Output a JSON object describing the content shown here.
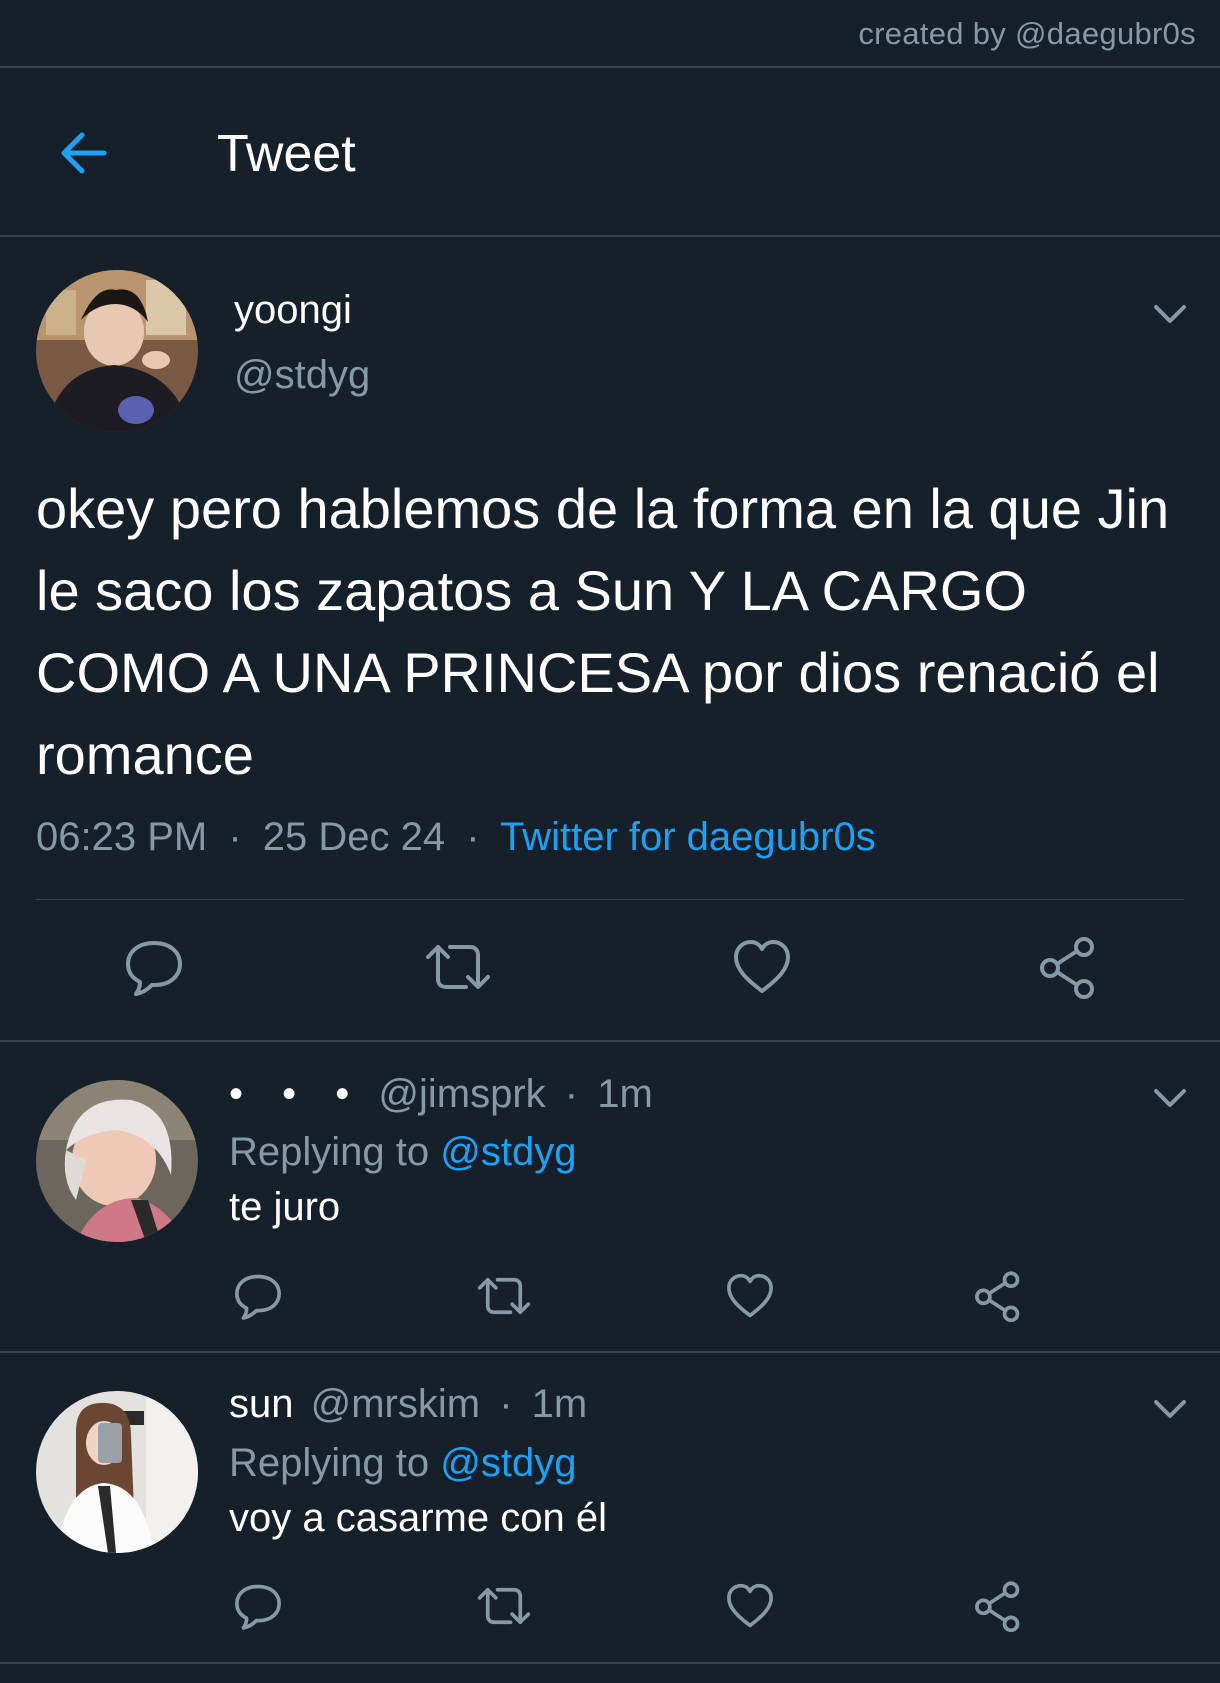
{
  "watermark": "created by @daegubr0s",
  "header": {
    "title": "Tweet",
    "back_icon": "arrow-left-icon"
  },
  "colors": {
    "background": "#15202b",
    "accent": "#1da1f2",
    "secondary_text": "#8899a6",
    "divider": "#38444d"
  },
  "tweet": {
    "name": "yoongi",
    "handle": "@stdyg",
    "text": "okey pero hablemos de la forma en la que Jin le saco los zapatos a Sun Y LA CARGO COMO A UNA PRINCESA por dios renació el romance",
    "time": "06:23 PM",
    "sep1": "·",
    "date": "25 Dec 24",
    "sep2": "·",
    "source": "Twitter for daegubr0s"
  },
  "replies": [
    {
      "name": "• • •",
      "handle": "@jimsprk",
      "sep": "·",
      "time": "1m",
      "replying_label": "Replying to",
      "replying_to": "@stdyg",
      "text": "te juro"
    },
    {
      "name": "sun",
      "handle": "@mrskim",
      "sep": "·",
      "time": "1m",
      "replying_label": "Replying to",
      "replying_to": "@stdyg",
      "text": "voy a casarme con él"
    }
  ]
}
